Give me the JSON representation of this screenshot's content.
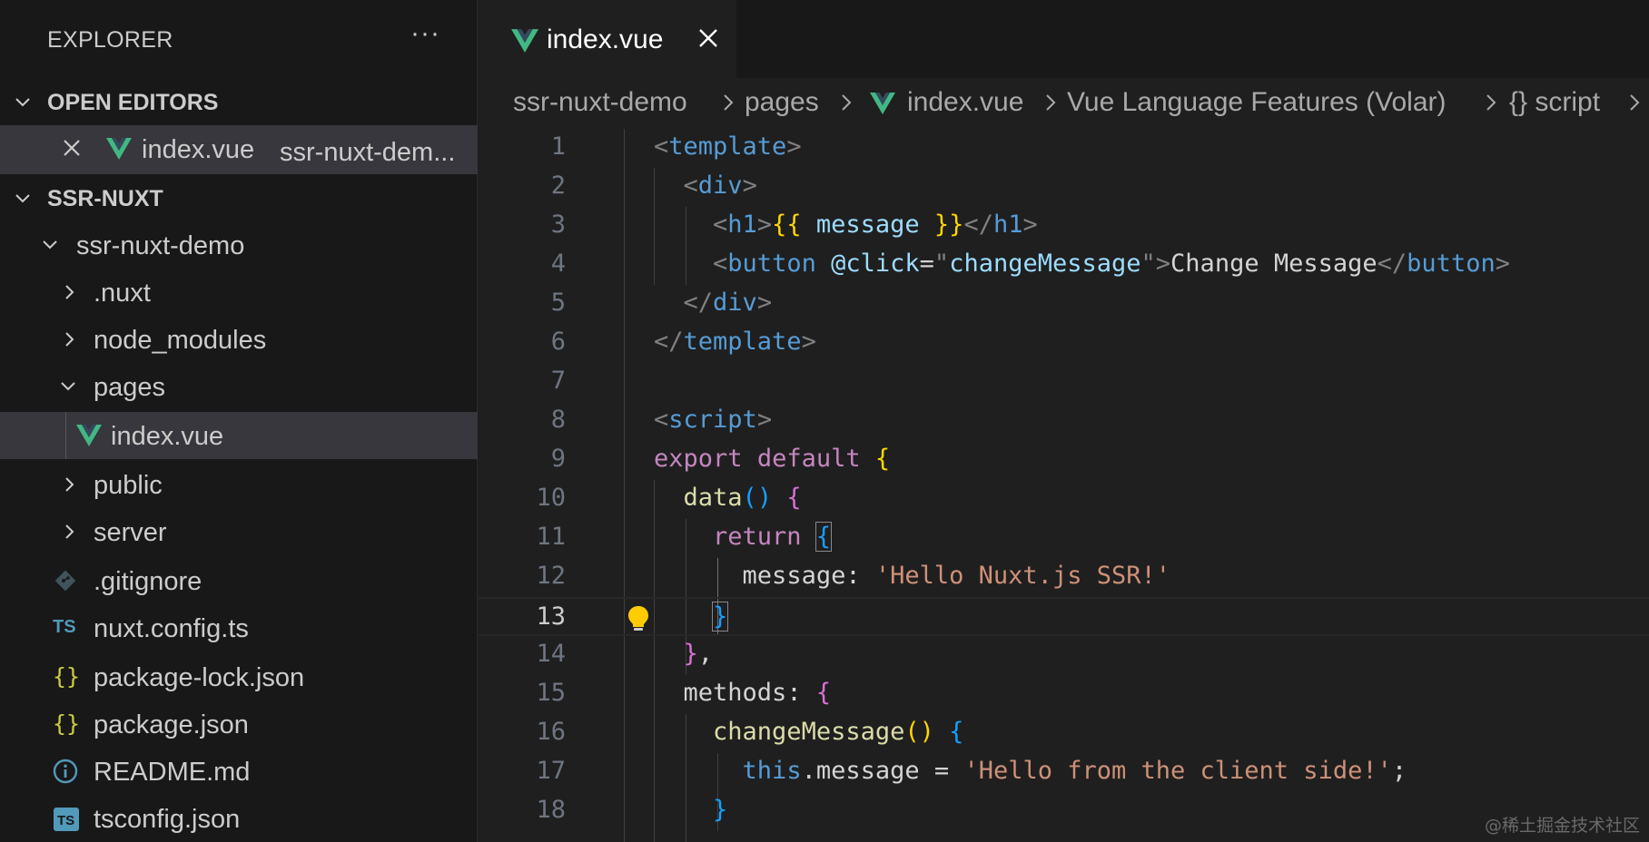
{
  "sidebar": {
    "title": "EXPLORER",
    "more": "···",
    "open_editors": {
      "label": "OPEN EDITORS",
      "items": [
        {
          "name": "index.vue",
          "description": "ssr-nuxt-dem..."
        }
      ]
    },
    "workspace": {
      "label": "SSR-NUXT",
      "tree": [
        {
          "label": "ssr-nuxt-demo",
          "kind": "folder-open"
        },
        {
          "label": ".nuxt",
          "kind": "folder"
        },
        {
          "label": "node_modules",
          "kind": "folder"
        },
        {
          "label": "pages",
          "kind": "folder-open"
        },
        {
          "label": "index.vue",
          "kind": "vue"
        },
        {
          "label": "public",
          "kind": "folder"
        },
        {
          "label": "server",
          "kind": "folder"
        },
        {
          "label": ".gitignore",
          "kind": "git"
        },
        {
          "label": "nuxt.config.ts",
          "kind": "ts",
          "icon_text": "TS"
        },
        {
          "label": "package-lock.json",
          "kind": "json",
          "icon_text": "{}"
        },
        {
          "label": "package.json",
          "kind": "json",
          "icon_text": "{}"
        },
        {
          "label": "README.md",
          "kind": "info"
        },
        {
          "label": "tsconfig.json",
          "kind": "tsconfig",
          "icon_text": "TS"
        }
      ]
    }
  },
  "editor": {
    "tab": {
      "label": "index.vue"
    },
    "breadcrumb": [
      "ssr-nuxt-demo",
      "pages",
      "index.vue",
      "Vue Language Features (Volar)",
      "{} script"
    ],
    "current_line": 13,
    "line_numbers": [
      "1",
      "2",
      "3",
      "4",
      "5",
      "6",
      "7",
      "8",
      "9",
      "10",
      "11",
      "12",
      "13",
      "14",
      "15",
      "16",
      "17",
      "18"
    ],
    "lines": [
      "<template>",
      "  <div>",
      "    <h1>{{ message }}</h1>",
      "    <button @click=\"changeMessage\">Change Message</button>",
      "  </div>",
      "</template>",
      "",
      "<script>",
      "export default {",
      "  data() {",
      "    return {",
      "      message: 'Hello Nuxt.js SSR!'",
      "    }",
      "  },",
      "  methods: {",
      "    changeMessage() {",
      "      this.message = 'Hello from the client side!';",
      "    }"
    ]
  },
  "watermark": "@稀土掘金技术社区",
  "colors": {
    "vue_green": "#41b883",
    "vue_dark": "#35495e",
    "ts_blue": "#519aba",
    "json_yellow": "#cbcb41",
    "bulb": "#ffcc00"
  }
}
